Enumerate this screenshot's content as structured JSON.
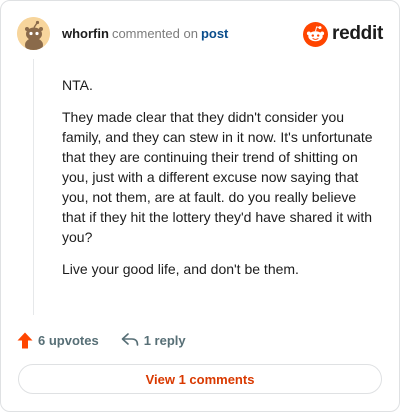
{
  "header": {
    "username": "whorfin",
    "action_text": "commented on",
    "post_link": "post",
    "brand_name": "reddit"
  },
  "comment": {
    "paragraphs": [
      "NTA.",
      "They made clear that they didn't consider you family, and they can stew in it now. It's unfortunate that they are continuing their trend of shitting on you, just with a different excuse now saying that you, not them, are at fault. do you really believe that if they hit the lottery they'd have shared it with you?",
      "Live your good life, and don't be them."
    ]
  },
  "actions": {
    "upvotes_label": "6 upvotes",
    "reply_label": "1 reply"
  },
  "footer": {
    "view_comments_label": "View 1 comments"
  },
  "icons": {
    "avatar": "snoo-avatar-icon",
    "brand": "reddit-logo-icon",
    "upvote": "upvote-arrow-icon",
    "reply": "reply-arrow-icon"
  },
  "colors": {
    "brand_orange": "#ff4500",
    "upvote_orange": "#ff4500",
    "link_blue": "#0a4d8c",
    "button_text": "#d93900",
    "muted_text": "#576f76"
  }
}
